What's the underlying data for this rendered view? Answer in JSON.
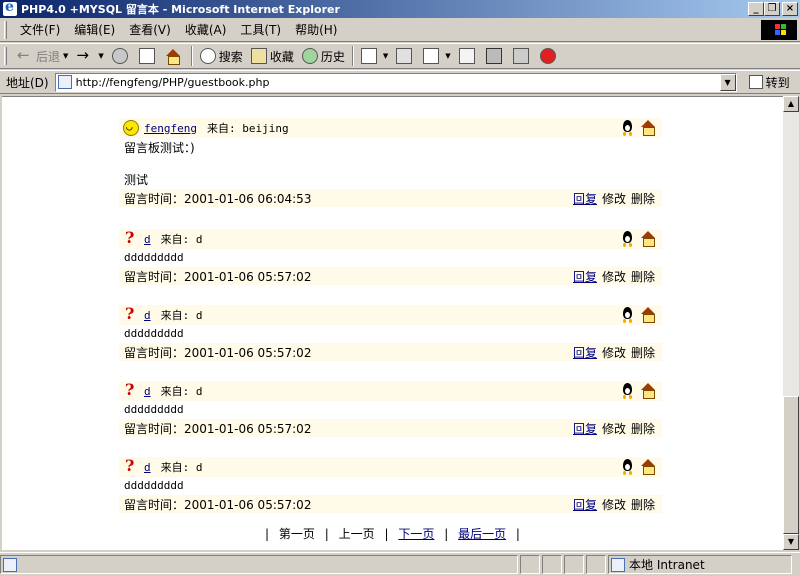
{
  "window": {
    "title": "PHP4.0 +MYSQL 留言本 - Microsoft Internet Explorer",
    "buttons": [
      "_",
      "❐",
      "×"
    ]
  },
  "menu": [
    "文件(F)",
    "编辑(E)",
    "查看(V)",
    "收藏(A)",
    "工具(T)",
    "帮助(H)"
  ],
  "toolbar": {
    "back": "后退",
    "search": "搜索",
    "favorites": "收藏",
    "history": "历史"
  },
  "address": {
    "label": "地址(D)",
    "url": "http://fengfeng/PHP/guestbook.php",
    "go": "转到"
  },
  "entries": [
    {
      "icon": "smiley-icon",
      "name": "fengfeng",
      "from": "来自: beijing",
      "lines": [
        "留言板测试：)",
        "",
        "测试"
      ],
      "time": "留言时间：2001-01-06 06:04:53",
      "actions": [
        "回复",
        "修改",
        "删除"
      ]
    },
    {
      "icon": "question-icon",
      "name": "d",
      "from": "来自: d",
      "lines": [
        "ddddddddd"
      ],
      "time": "留言时间：2001-01-06 05:57:02",
      "actions": [
        "回复",
        "修改",
        "删除"
      ]
    },
    {
      "icon": "question-icon",
      "name": "d",
      "from": "来自: d",
      "lines": [
        "ddddddddd"
      ],
      "time": "留言时间：2001-01-06 05:57:02",
      "actions": [
        "回复",
        "修改",
        "删除"
      ]
    },
    {
      "icon": "question-icon",
      "name": "d",
      "from": "来自: d",
      "lines": [
        "ddddddddd"
      ],
      "time": "留言时间：2001-01-06 05:57:02",
      "actions": [
        "回复",
        "修改",
        "删除"
      ]
    },
    {
      "icon": "question-icon",
      "name": "d",
      "from": "来自: d",
      "lines": [
        "ddddddddd"
      ],
      "time": "留言时间：2001-01-06 05:57:02",
      "actions": [
        "回复",
        "修改",
        "删除"
      ]
    }
  ],
  "pager": {
    "sep": "|",
    "first": "第一页",
    "prev": "上一页",
    "next": "下一页",
    "last": "最后一页"
  },
  "status": {
    "zone": "本地 Intranet"
  }
}
